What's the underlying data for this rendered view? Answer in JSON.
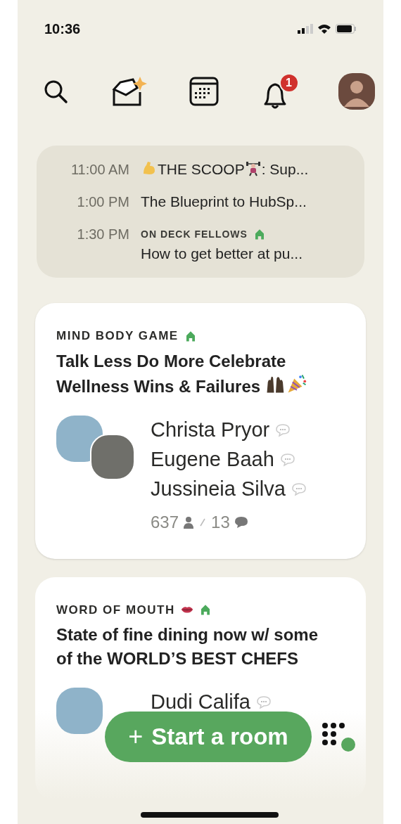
{
  "status_bar": {
    "time": "10:36"
  },
  "top_bar": {
    "notification_badge": "1"
  },
  "upcoming": [
    {
      "time": "11:00 AM",
      "title": [
        {
          "kind": "biceps"
        },
        {
          "kind": "text",
          "text": "THE SCOOP"
        },
        {
          "kind": "weightlifter"
        },
        {
          "kind": "text",
          "text": ": Sup..."
        }
      ]
    },
    {
      "time": "1:00 PM",
      "title": [
        {
          "kind": "text",
          "text": "The Blueprint to HubSp..."
        }
      ]
    },
    {
      "time": "1:30 PM",
      "club": {
        "name": "ON DECK FELLOWS",
        "icons": [
          {
            "kind": "house"
          }
        ]
      },
      "title": [
        {
          "kind": "text",
          "text": "How to get better at pu..."
        }
      ]
    }
  ],
  "rooms": [
    {
      "club": {
        "name": "MIND BODY GAME",
        "icons": [
          {
            "kind": "house"
          }
        ]
      },
      "title": [
        {
          "kind": "text",
          "text": "Talk Less Do More Celebrate Wellness Wins & Failures "
        },
        {
          "kind": "raised-hands"
        },
        {
          "kind": "party-popper"
        }
      ],
      "speakers": [
        "Christa Pryor",
        "Eugene Baah",
        "Jussineia Silva"
      ],
      "listeners": "637",
      "speaking": "13",
      "faded": false
    },
    {
      "club": {
        "name": "WORD OF MOUTH",
        "icons": [
          {
            "kind": "lips"
          },
          {
            "kind": "house"
          }
        ]
      },
      "title": [
        {
          "kind": "text",
          "text": "State of fine dining now w/ some of the WORLD’S BEST CHEFS"
        }
      ],
      "speakers": [
        "Dudi Califa"
      ],
      "faded": true
    }
  ],
  "start_room_button": {
    "icon": "+",
    "label": "Start a room"
  }
}
